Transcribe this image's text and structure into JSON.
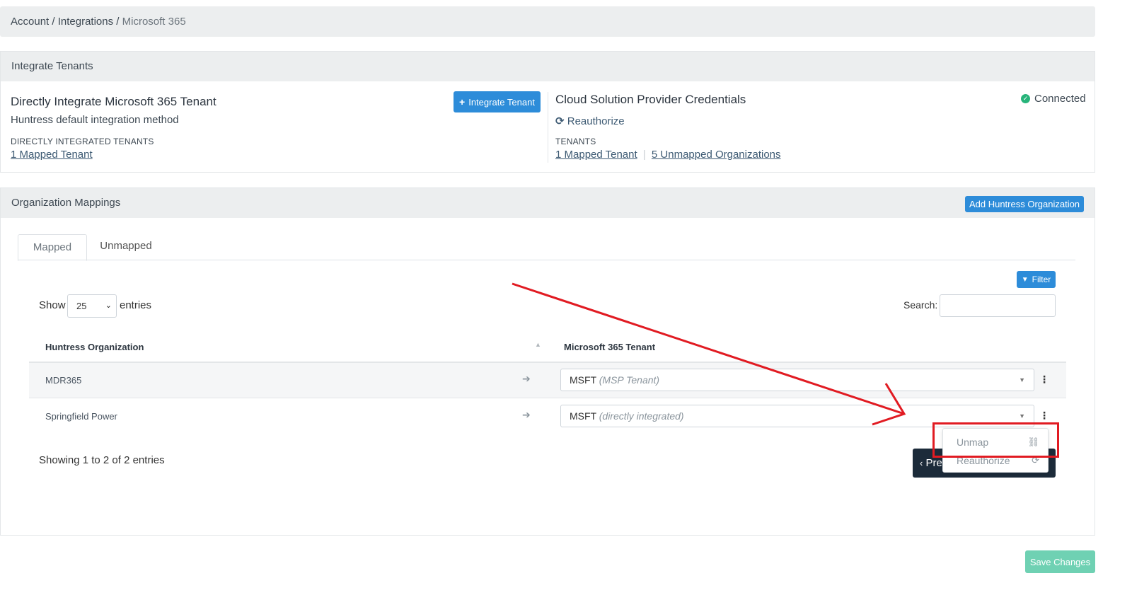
{
  "breadcrumb": {
    "account": "Account",
    "sep": " / ",
    "integrations": "Integrations",
    "current": "Microsoft 365"
  },
  "integrate_panel": {
    "header": "Integrate Tenants",
    "direct": {
      "title": "Directly Integrate Microsoft 365 Tenant",
      "subtitle": "Huntress default integration method",
      "caption": "DIRECTLY INTEGRATED TENANTS",
      "link": "1 Mapped Tenant",
      "button": "Integrate Tenant"
    },
    "csp": {
      "title": "Cloud Solution Provider Credentials",
      "status": "Connected",
      "reauthorize": "Reauthorize",
      "caption": "TENANTS",
      "mapped_link": "1 Mapped Tenant",
      "sep": "|",
      "unmapped_link": "5 Unmapped Organizations"
    }
  },
  "mappings_panel": {
    "header": "Organization Mappings",
    "add_button": "Add Huntress Organization",
    "tabs": {
      "mapped": "Mapped",
      "unmapped": "Unmapped"
    },
    "filter_button": "Filter",
    "show_label": "Show",
    "entries_value": "25",
    "entries_label": "entries",
    "search_label": "Search:",
    "columns": {
      "org": "Huntress Organization",
      "tenant": "Microsoft 365 Tenant"
    },
    "rows": [
      {
        "org": "MDR365",
        "tenant": "MSFT",
        "tenant_note": "(MSP Tenant)"
      },
      {
        "org": "Springfield Power",
        "tenant": "MSFT",
        "tenant_note": "(directly integrated)"
      }
    ],
    "showing": "Showing 1 to 2 of 2 entries",
    "pager_label": "Pre",
    "menu": {
      "unmap": "Unmap",
      "reauthorize": "Reauthorize"
    }
  },
  "save_button": "Save Changes",
  "colors": {
    "primary": "#2d8cd9",
    "success": "#27b47a",
    "annotation": "#e11b22",
    "save": "#6fd1b3"
  }
}
